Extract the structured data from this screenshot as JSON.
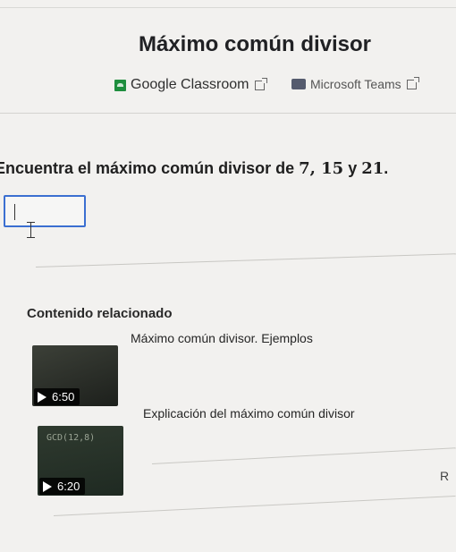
{
  "page": {
    "title": "Máximo común divisor"
  },
  "share": {
    "classroom_label": "Google Classroom",
    "teams_label": "Microsoft Teams",
    "classroom_icon": "google-classroom-icon",
    "teams_icon": "microsoft-teams-icon",
    "external_icon": "external-link-icon"
  },
  "question": {
    "prompt": "Encuentra el máximo común divisor de ",
    "numbers": "7, 15",
    "connector": " y ",
    "last_number": "21",
    "end": ".",
    "answer_value": ""
  },
  "related": {
    "heading": "Contenido relacionado",
    "videos": [
      {
        "title": "Máximo común divisor. Ejemplos",
        "duration": "6:50",
        "thumb_text": ""
      },
      {
        "title": "Explicación del máximo común divisor",
        "duration": "6:20",
        "thumb_text": "GCD(12,8)"
      }
    ]
  },
  "edge_fragment": "R",
  "colors": {
    "accent": "#3b6fd1",
    "classroom_green": "#1e8e3e",
    "background": "#f2f1ef"
  }
}
